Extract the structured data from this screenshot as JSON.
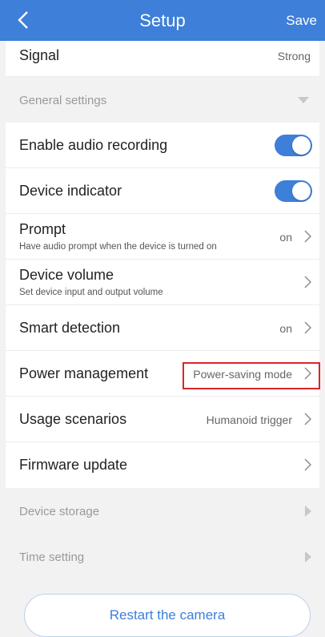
{
  "header": {
    "title": "Setup",
    "save_label": "Save"
  },
  "signal": {
    "label": "Signal",
    "value": "Strong"
  },
  "general": {
    "label": "General settings"
  },
  "audio_recording": {
    "label": "Enable audio recording",
    "enabled": true
  },
  "device_indicator": {
    "label": "Device indicator",
    "enabled": true
  },
  "prompt": {
    "label": "Prompt",
    "sublabel": "Have audio prompt when the device is turned on",
    "value": "on"
  },
  "device_volume": {
    "label": "Device volume",
    "sublabel": "Set device input and output volume"
  },
  "smart_detection": {
    "label": "Smart detection",
    "value": "on"
  },
  "power_management": {
    "label": "Power management",
    "value": "Power-saving mode"
  },
  "usage_scenarios": {
    "label": "Usage scenarios",
    "value": "Humanoid trigger"
  },
  "firmware_update": {
    "label": "Firmware update"
  },
  "device_storage": {
    "label": "Device storage"
  },
  "time_setting": {
    "label": "Time setting"
  },
  "restart": {
    "label": "Restart the camera"
  },
  "colors": {
    "accent": "#3d7fd9",
    "highlight": "#d9262b",
    "background": "#f2f2f2"
  }
}
